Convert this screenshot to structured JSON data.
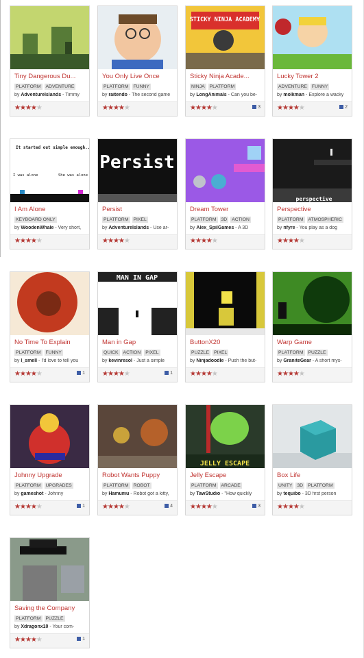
{
  "games": [
    {
      "title": "Tiny Dangerous Du...",
      "tags": [
        "PLATFORM",
        "ADVENTURE"
      ],
      "author": "AdventureIslands",
      "desc": "Timmy",
      "rating": 3.5,
      "comments": ""
    },
    {
      "title": "You Only Live Once",
      "tags": [
        "PLATFORM",
        "FUNNY"
      ],
      "author": "raitendo",
      "desc": "The second game",
      "rating": 3.5,
      "comments": ""
    },
    {
      "title": "Sticky Ninja Acade...",
      "tags": [
        "NINJA",
        "PLATFORM"
      ],
      "author": "LongAnimals",
      "desc": "Can you be-",
      "rating": 3.5,
      "comments": "3",
      "thumb_text": "STICKY NINJA ACADEMY"
    },
    {
      "title": "Lucky Tower 2",
      "tags": [
        "ADVENTURE",
        "FUNNY"
      ],
      "author": "molkman",
      "desc": "Explore a wacky",
      "rating": 4,
      "comments": "2"
    },
    {
      "title": "I Am Alone",
      "tags": [
        "KEYBOARD ONLY"
      ],
      "author": "WoodenWhale",
      "desc": "Very short,",
      "rating": 4,
      "comments": "",
      "thumb_text": "It started out simple enough...",
      "thumb_text2": "I was alone",
      "thumb_text3": "She was alone"
    },
    {
      "title": "Persist",
      "tags": [
        "PLATFORM",
        "PIXEL"
      ],
      "author": "AdventureIslands",
      "desc": "Use ar-",
      "rating": 3.5,
      "comments": "",
      "thumb_text": "Persist"
    },
    {
      "title": "Dream Tower",
      "tags": [
        "PLATFORM",
        "3D",
        "ACTION"
      ],
      "author": "Alex_SpilGames",
      "desc": "A 3D",
      "rating": 3.5,
      "comments": ""
    },
    {
      "title": "Perspective",
      "tags": [
        "PLATFORM",
        "ATMOSPHERIC"
      ],
      "author": "nfyre",
      "desc": "You play as a dog",
      "rating": 4,
      "comments": "",
      "thumb_text": "perspective"
    },
    {
      "title": "No Time To Explain",
      "tags": [
        "PLATFORM",
        "FUNNY"
      ],
      "author": "l_smell",
      "desc": "I'd love to tell you",
      "rating": 4,
      "comments": "1"
    },
    {
      "title": "Man in Gap",
      "tags": [
        "QUICK",
        "ACTION",
        "PIXEL"
      ],
      "author": "kevinresol",
      "desc": "Just a simple",
      "rating": 4,
      "comments": "1",
      "thumb_text": "MAN IN GAP"
    },
    {
      "title": "ButtonX20",
      "tags": [
        "PUZZLE",
        "PIXEL"
      ],
      "author": "Ninjadoodle",
      "desc": "Push the but-",
      "rating": 4,
      "comments": ""
    },
    {
      "title": "Warp Game",
      "tags": [
        "PLATFORM",
        "PUZZLE"
      ],
      "author": "GraniteGear",
      "desc": "A short mys-",
      "rating": 4,
      "comments": ""
    },
    {
      "title": "Johnny Upgrade",
      "tags": [
        "PLATFORM",
        "UPGRADES"
      ],
      "author": "gameshot",
      "desc": "Johnny",
      "rating": 4,
      "comments": "1"
    },
    {
      "title": "Robot Wants Puppy",
      "tags": [
        "PLATFORM",
        "ROBOT"
      ],
      "author": "Hamumu",
      "desc": "Robot got a kitty,",
      "rating": 4,
      "comments": "4"
    },
    {
      "title": "Jelly Escape",
      "tags": [
        "PLATFORM",
        "ARCADE"
      ],
      "author": "TawStudio",
      "desc": "\"How quickly",
      "rating": 4,
      "comments": "3",
      "thumb_text": "JELLY ESCAPE"
    },
    {
      "title": "Box Life",
      "tags": [
        "UNITY",
        "3D",
        "PLATFORM"
      ],
      "author": "tequibo",
      "desc": "3D first person",
      "rating": 4,
      "comments": ""
    },
    {
      "title": "Saving the Company",
      "tags": [
        "PLATFORM",
        "PUZZLE"
      ],
      "author": "Xdragonx10",
      "desc": "Your com-",
      "rating": 4,
      "comments": "1"
    }
  ],
  "colors": {
    "title": "#c13532",
    "star_on": "#b53a36",
    "star_off": "#c4c4c4",
    "comment": "#3e5da6"
  }
}
